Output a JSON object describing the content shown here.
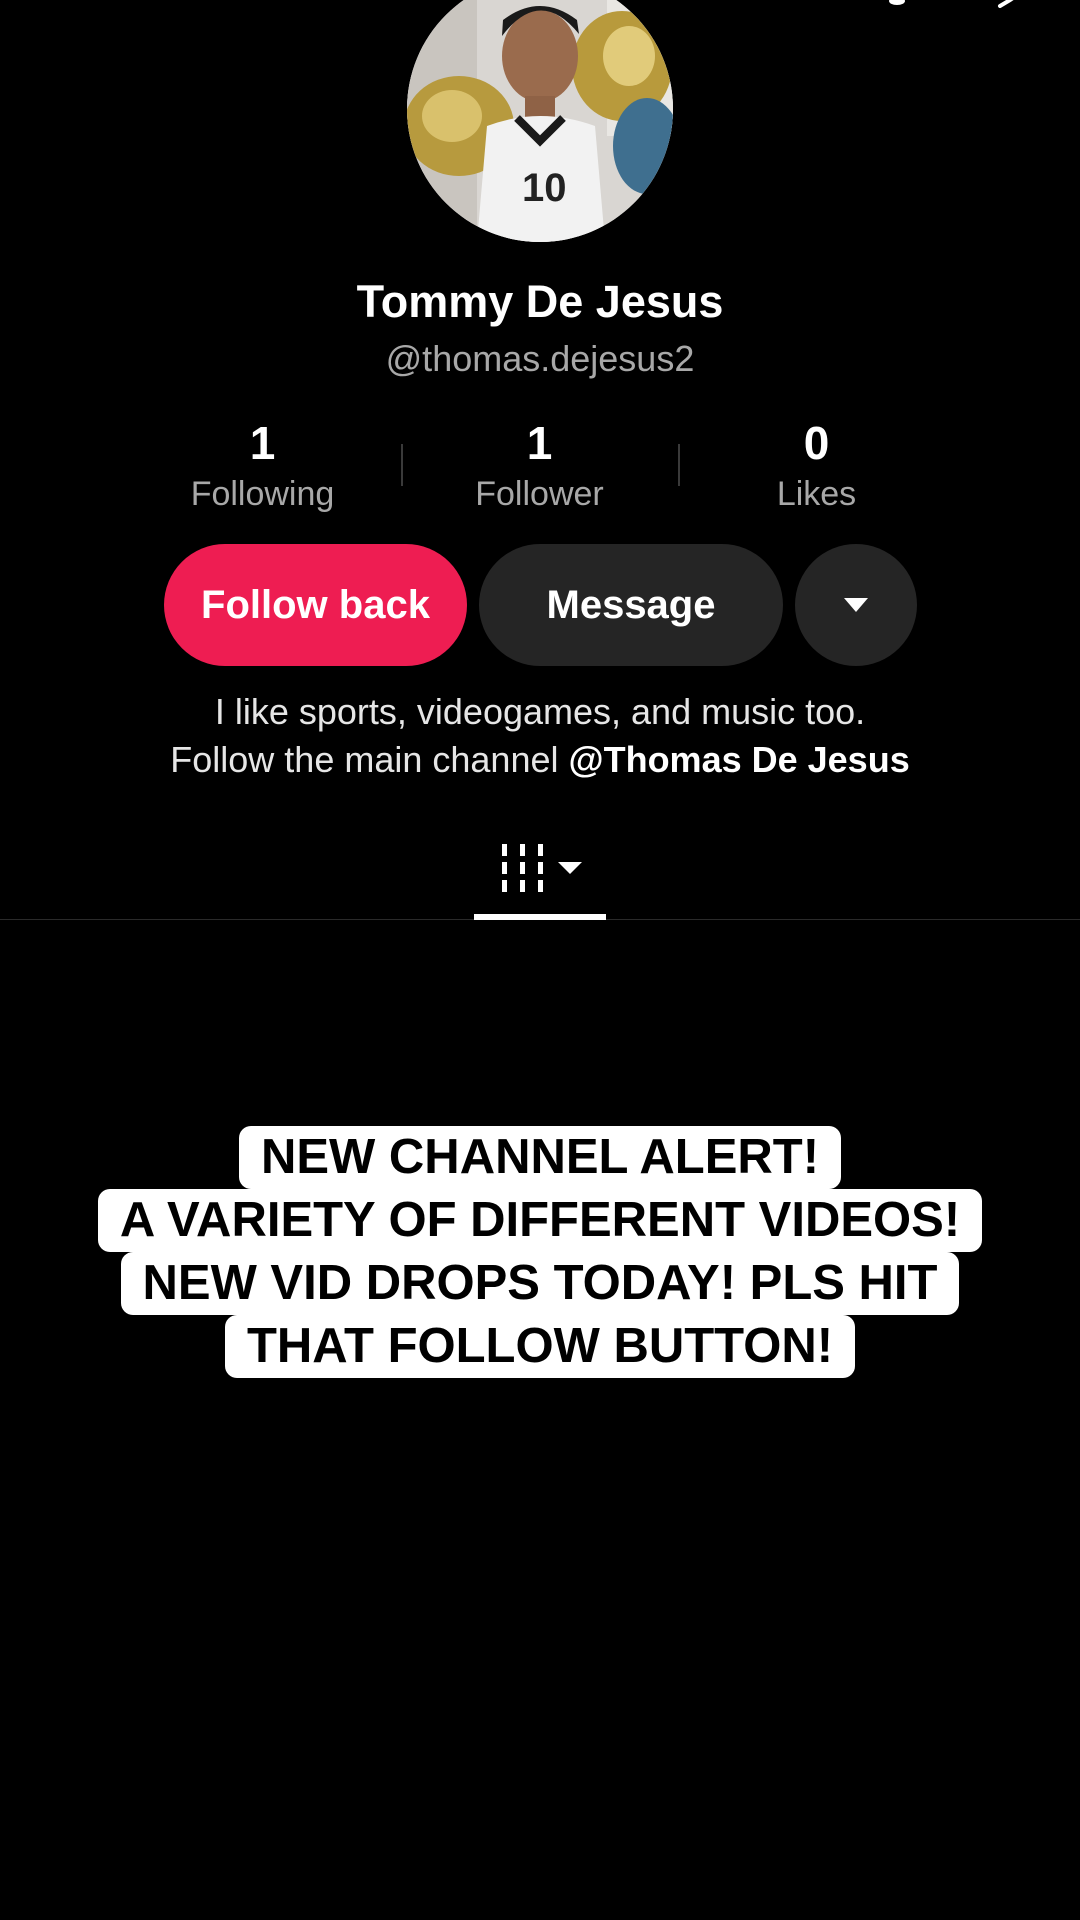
{
  "profile": {
    "display_name": "Tommy De Jesus",
    "username": "@thomas.dejesus2",
    "bio_line1": "I like sports, videogames, and music too.",
    "bio_line2_prefix": "Follow the main channel ",
    "bio_link": "@Thomas De Jesus"
  },
  "stats": [
    {
      "value": "1",
      "label": "Following"
    },
    {
      "value": "1",
      "label": "Follower"
    },
    {
      "value": "0",
      "label": "Likes"
    }
  ],
  "actions": {
    "follow_label": "Follow back",
    "message_label": "Message"
  },
  "overlay_caption": [
    "NEW CHANNEL ALERT!",
    "A VARIETY OF DIFFERENT VIDEOS!",
    "NEW VID DROPS TODAY! PLS HIT",
    "THAT FOLLOW BUTTON!"
  ],
  "icons": {
    "back": "chevron-left-icon",
    "notifications": "bell-icon",
    "share": "share-icon",
    "more": "caret-down-icon",
    "videos_tab": "grid-icon"
  },
  "colors": {
    "background": "#000000",
    "accent": "#ee1d52",
    "secondary_button": "#252525",
    "muted_text": "#a8a8a8"
  }
}
